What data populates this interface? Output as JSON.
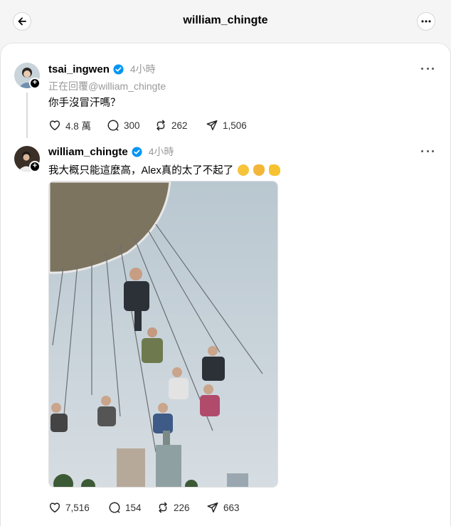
{
  "header": {
    "title": "william_chingte",
    "back_icon": "arrow-left-icon",
    "more_icon": "more-horizontal-icon"
  },
  "posts": [
    {
      "username": "tsai_ingwen",
      "verified": true,
      "time": "4小時",
      "reply_to": "正在回覆@william_chingte",
      "text": "你手沒冒汗嗎？",
      "likes": "4.8 萬",
      "comments": "300",
      "reposts": "262",
      "shares": "1,506"
    },
    {
      "username": "william_chingte",
      "verified": true,
      "time": "4小時",
      "text": "我大概只能這麼高，Alex真的太了不起了",
      "emojis": [
        "tears-of-joy-emoji",
        "clapping-hands-emoji",
        "thumbs-up-emoji"
      ],
      "image_alt": "swing-ride-photo",
      "likes": "7,516",
      "comments": "154",
      "reposts": "226",
      "shares": "663"
    }
  ],
  "colors": {
    "background": "#f5f5f5",
    "verified": "#0095f6",
    "muted": "#999999"
  }
}
